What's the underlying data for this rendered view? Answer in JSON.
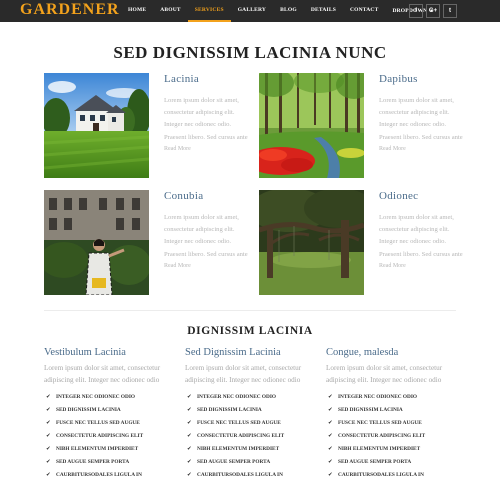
{
  "brand": "GARDENER",
  "nav": [
    {
      "label": "HOME",
      "active": false
    },
    {
      "label": "ABOUT",
      "active": false
    },
    {
      "label": "SERVICES",
      "active": true
    },
    {
      "label": "GALLERY",
      "active": false
    },
    {
      "label": "BLOG",
      "active": false
    },
    {
      "label": "DETAILS",
      "active": false
    },
    {
      "label": "CONTACT",
      "active": false
    },
    {
      "label": "DROPDOWN",
      "active": false
    }
  ],
  "social": [
    {
      "icon": "facebook-icon",
      "glyph": "f"
    },
    {
      "icon": "google-plus-icon",
      "glyph": "G+"
    },
    {
      "icon": "twitter-icon",
      "glyph": "t"
    }
  ],
  "colors": {
    "accent": "#f3a21c",
    "navbar": "#2a2a2a",
    "heading_blue": "#4a6b8a"
  },
  "main_title": "SED DIGNISSIM LACINIA NUNC",
  "articles": [
    {
      "title": "Lacinia",
      "body": "Lorem ipsum dolor sit amet, consectetur adipiscing elit. Integer nec odionec odio. Praesent libero. Sed cursus ante",
      "more": "Read More"
    },
    {
      "title": "Dapibus",
      "body": "Lorem ipsum dolor sit amet, consectetur adipiscing elit. Integer nec odionec odio. Praesent libero. Sed cursus ante",
      "more": "Read More"
    },
    {
      "title": "Conubia",
      "body": "Lorem ipsum dolor sit amet, consectetur adipiscing elit. Integer nec odionec odio. Praesent libero. Sed cursus ante",
      "more": "Read More"
    },
    {
      "title": "Odionec",
      "body": "Lorem ipsum dolor sit amet, consectetur adipiscing elit. Integer nec odionec odio. Praesent libero. Sed cursus ante",
      "more": "Read More"
    }
  ],
  "sub_title": "DIGNISSIM LACINIA",
  "columns": [
    {
      "title": "Vestibulum Lacinia",
      "body": [
        "Lorem ipsum dolor sit amet, consectetur",
        "adipiscing elit. Integer nec odionec odio"
      ],
      "items": [
        "INTEGER NEC ODIONEC ODIO",
        "SED DIGNISSIM LACINIA",
        "FUSCE NEC TELLUS SED AUGUE",
        "CONSECTETUR ADIPISCING ELIT",
        "NIBH ELEMENTUM IMPERDIET",
        "SED AUGUE SEMPER PORTA",
        "CAURBITURSODALES LIGULA IN"
      ]
    },
    {
      "title": "Sed Dignissim Lacinia",
      "body": [
        "Lorem ipsum dolor sit amet, consectetur",
        "adipiscing elit. Integer nec odionec odio"
      ],
      "items": [
        "INTEGER NEC ODIONEC ODIO",
        "SED DIGNISSIM LACINIA",
        "FUSCE NEC TELLUS SED AUGUE",
        "CONSECTETUR ADIPISCING ELIT",
        "NIBH ELEMENTUM IMPERDIET",
        "SED AUGUE SEMPER PORTA",
        "CAURBITURSODALES LIGULA IN"
      ]
    },
    {
      "title": "Congue, malesda",
      "body": [
        "Lorem ipsum dolor sit amet, consectetur",
        "adipiscing elit. Integer nec odionec odio"
      ],
      "items": [
        "INTEGER NEC ODIONEC ODIO",
        "SED DIGNISSIM LACINIA",
        "FUSCE NEC TELLUS SED AUGUE",
        "CONSECTETUR ADIPISCING ELIT",
        "NIBH ELEMENTUM IMPERDIET",
        "SED AUGUE SEMPER PORTA",
        "CAURBITURSODALES LIGULA IN"
      ]
    }
  ]
}
